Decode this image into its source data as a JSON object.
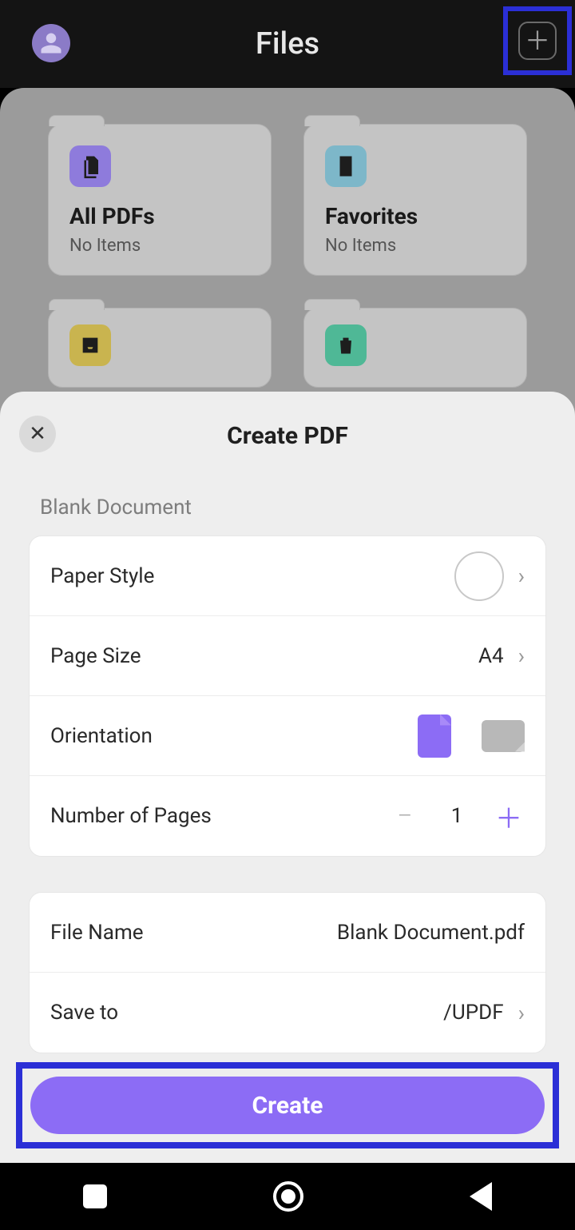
{
  "header": {
    "title": "Files"
  },
  "folders": {
    "allpdfs": {
      "title": "All PDFs",
      "sub": "No Items"
    },
    "favorites": {
      "title": "Favorites",
      "sub": "No Items"
    }
  },
  "sheet": {
    "title": "Create PDF",
    "section": "Blank Document",
    "rows": {
      "paper_style": {
        "label": "Paper Style"
      },
      "page_size": {
        "label": "Page Size",
        "value": "A4"
      },
      "orientation": {
        "label": "Orientation"
      },
      "pages": {
        "label": "Number of Pages",
        "value": "1"
      },
      "file_name": {
        "label": "File Name",
        "value": "Blank Document.pdf"
      },
      "save_to": {
        "label": "Save to",
        "value": "/UPDF"
      }
    },
    "create_label": "Create"
  }
}
